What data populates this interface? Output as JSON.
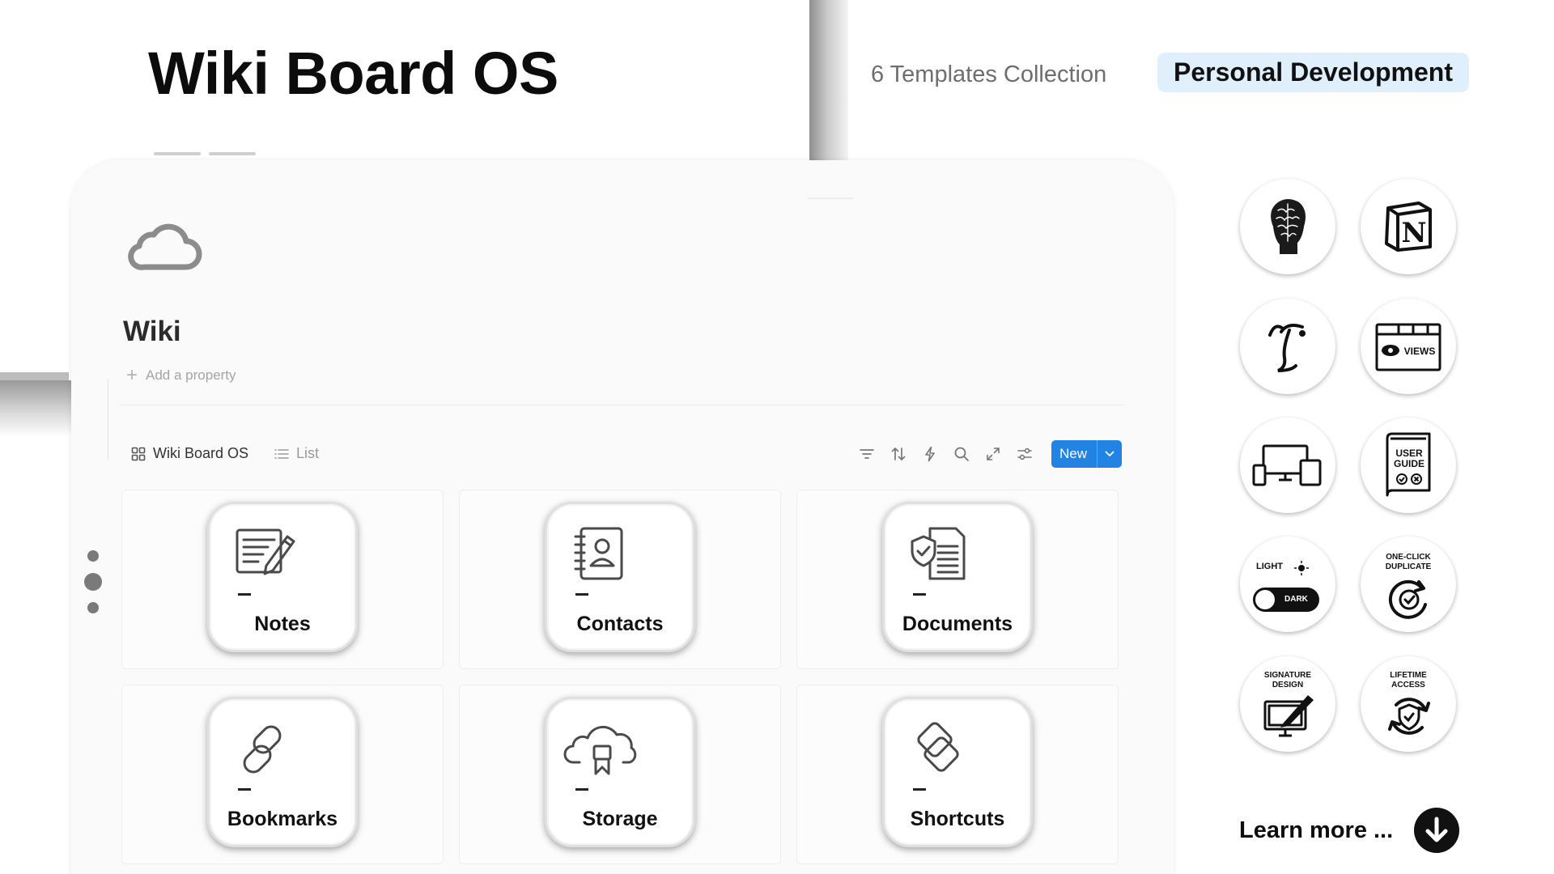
{
  "header": {
    "title": "Wiki Board OS",
    "collection_label": "6 Templates Collection",
    "category_badge": "Personal Development"
  },
  "page": {
    "icon": "cloud-icon",
    "title": "Wiki",
    "add_property": "Add a property"
  },
  "views": [
    {
      "label": "Wiki Board OS",
      "icon": "gallery-icon",
      "active": true
    },
    {
      "label": "List",
      "icon": "list-icon",
      "active": false
    }
  ],
  "toolbar": {
    "icons": [
      "filter-icon",
      "sort-icon",
      "automation-icon",
      "search-icon",
      "expand-icon",
      "settings-icon"
    ],
    "new_label": "New"
  },
  "cards": [
    {
      "label": "Notes",
      "icon": "notes-icon"
    },
    {
      "label": "Contacts",
      "icon": "contacts-icon"
    },
    {
      "label": "Documents",
      "icon": "documents-icon"
    },
    {
      "label": "Bookmarks",
      "icon": "bookmarks-icon"
    },
    {
      "label": "Storage",
      "icon": "storage-icon"
    },
    {
      "label": "Shortcuts",
      "icon": "shortcuts-icon"
    }
  ],
  "features": {
    "brain": {
      "icon": "brain-head-icon"
    },
    "notion": {
      "icon": "notion-logo-icon",
      "text": "N"
    },
    "minimal": {
      "icon": "minimal-design-icon"
    },
    "views": {
      "icon": "views-window-icon",
      "text": "VIEWS"
    },
    "devices": {
      "icon": "devices-icon"
    },
    "user_guide": {
      "icon": "user-guide-icon",
      "text_1": "USER",
      "text_2": "GUIDE"
    },
    "theme": {
      "icon": "light-dark-toggle-icon",
      "light": "LIGHT",
      "dark": "DARK"
    },
    "duplicate": {
      "icon": "one-click-duplicate-icon",
      "text_1": "ONE-CLICK",
      "text_2": "DUPLICATE"
    },
    "signature": {
      "icon": "signature-design-icon",
      "text_1": "SIGNATURE",
      "text_2": "DESIGN"
    },
    "lifetime": {
      "icon": "lifetime-access-icon",
      "text_1": "LIFETIME",
      "text_2": "ACCESS"
    }
  },
  "learn_more": {
    "label": "Learn more ...",
    "icon": "arrow-down-icon"
  },
  "colors": {
    "accent": "#2383e2",
    "badge_bg": "#dfeffc"
  }
}
